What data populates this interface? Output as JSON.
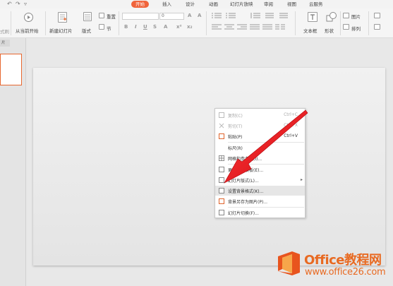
{
  "quick_access": {
    "undo": "↶",
    "redo": "↷",
    "more": "▿"
  },
  "tabs": [
    {
      "label": "开始",
      "active": true
    },
    {
      "label": "插入"
    },
    {
      "label": "设计"
    },
    {
      "label": "动画"
    },
    {
      "label": "幻灯片放映"
    },
    {
      "label": "审阅"
    },
    {
      "label": "视图"
    },
    {
      "label": "云服务"
    }
  ],
  "ribbon": {
    "format_painter": "式刷",
    "from_current": "从当前开始",
    "new_slide": "新建幻灯片",
    "layout": "版式",
    "reset": "重置",
    "section": "节",
    "font_size": "0",
    "textbox": "文本框",
    "shape": "形状",
    "picture": "图片",
    "arrange": "排列"
  },
  "left_panel": {
    "header": "片"
  },
  "context_menu": {
    "items": [
      {
        "label": "复制(C)",
        "shortcut": "Ctrl+C",
        "disabled": true,
        "icon": "copy-icon"
      },
      {
        "label": "剪切(T)",
        "shortcut": "Ctrl+X",
        "disabled": true,
        "icon": "scissors-icon"
      },
      {
        "label": "粘贴(P)",
        "shortcut": "Ctrl+V",
        "disabled": false,
        "icon": "paste-icon"
      },
      {
        "label": "标尺(R)",
        "shortcut": "",
        "disabled": false,
        "icon": ""
      },
      {
        "label": "网格和参考线(I)...",
        "shortcut": "",
        "disabled": false,
        "icon": "grid-icon"
      },
      {
        "label": "更多设计模板(E)...",
        "shortcut": "",
        "disabled": false,
        "icon": "template-icon"
      },
      {
        "label": "幻灯片版式(L)...",
        "shortcut": "",
        "disabled": false,
        "icon": "layout-icon",
        "submenu": true
      },
      {
        "label": "设置背景格式(K)...",
        "shortcut": "",
        "disabled": false,
        "icon": "background-icon",
        "highlighted": true
      },
      {
        "label": "背景另存为图片(P)...",
        "shortcut": "",
        "disabled": false,
        "icon": "save-picture-icon"
      },
      {
        "label": "幻灯片切换(F)...",
        "shortcut": "",
        "disabled": false,
        "icon": "transition-icon"
      }
    ]
  },
  "watermark": {
    "brand": "Office教程网",
    "url": "www.office26.com"
  },
  "colors": {
    "accent": "#f0643b",
    "arrow": "#e8141c",
    "logo": "#e86a22"
  }
}
